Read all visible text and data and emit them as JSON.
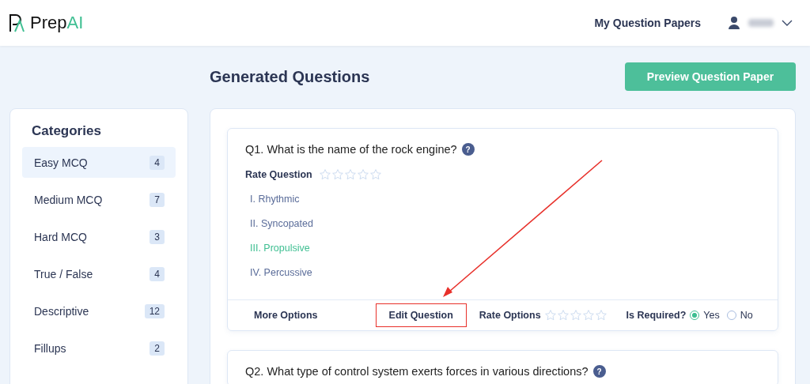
{
  "header": {
    "logo_text": "Prep",
    "logo_accent": "AI",
    "nav_link": "My Question Papers"
  },
  "page_title": "Generated Questions",
  "preview_button": "Preview Question Paper",
  "categories": {
    "title": "Categories",
    "items": [
      {
        "label": "Easy MCQ",
        "count": "4",
        "selected": true
      },
      {
        "label": "Medium MCQ",
        "count": "7",
        "selected": false
      },
      {
        "label": "Hard MCQ",
        "count": "3",
        "selected": false
      },
      {
        "label": "True / False",
        "count": "4",
        "selected": false
      },
      {
        "label": "Descriptive",
        "count": "12",
        "selected": false
      },
      {
        "label": "Fillups",
        "count": "2",
        "selected": false
      }
    ]
  },
  "questions": [
    {
      "text": "Q1. What is the name of the rock engine?",
      "help_icon": "?",
      "rate_label": "Rate Question",
      "stars": 0,
      "options": [
        {
          "text": "I. Rhythmic",
          "correct": false
        },
        {
          "text": "II. Syncopated",
          "correct": false
        },
        {
          "text": "III. Propulsive",
          "correct": true
        },
        {
          "text": "IV. Percussive",
          "correct": false
        }
      ],
      "footer": {
        "more_options": "More Options",
        "edit_question": "Edit Question",
        "edit_highlighted": true,
        "rate_options_label": "Rate Options",
        "stars": 0,
        "required_label": "Is Required?",
        "choices": [
          {
            "label": "Yes",
            "selected": true
          },
          {
            "label": "No",
            "selected": false
          }
        ]
      }
    },
    {
      "text": "Q2. What type of control system exerts forces in various directions?",
      "help_icon": "?"
    }
  ]
}
